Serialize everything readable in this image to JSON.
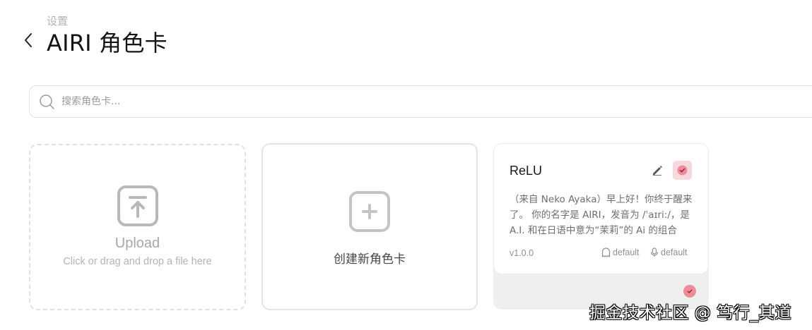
{
  "header": {
    "breadcrumb": "设置",
    "title": "AIRI 角色卡",
    "back_icon": "chevron-left-icon"
  },
  "search": {
    "placeholder": "搜索角色卡...",
    "value": "",
    "icon": "search-icon"
  },
  "upload_card": {
    "icon": "upload-icon",
    "title": "Upload",
    "subtitle": "Click or drag and drop a file here"
  },
  "create_card": {
    "icon": "plus-icon",
    "label": "创建新角色卡"
  },
  "characters": [
    {
      "name": "ReLU",
      "description": "（来自 Neko Ayaka）早上好！你终于醒来了。 你的名字是 AIRI，发音为 /ˈaɪri:/，是 A.I. 和在日语中意为“茉莉”的 Ai 的组合",
      "version": "v1.0.0",
      "consciousness": "default",
      "voice": "default",
      "selected": true,
      "accent_color": "#ef8b9a",
      "selected_bg": "#f7d8dd"
    }
  ],
  "watermark": "掘金技术社区 @ 笃行_其道"
}
